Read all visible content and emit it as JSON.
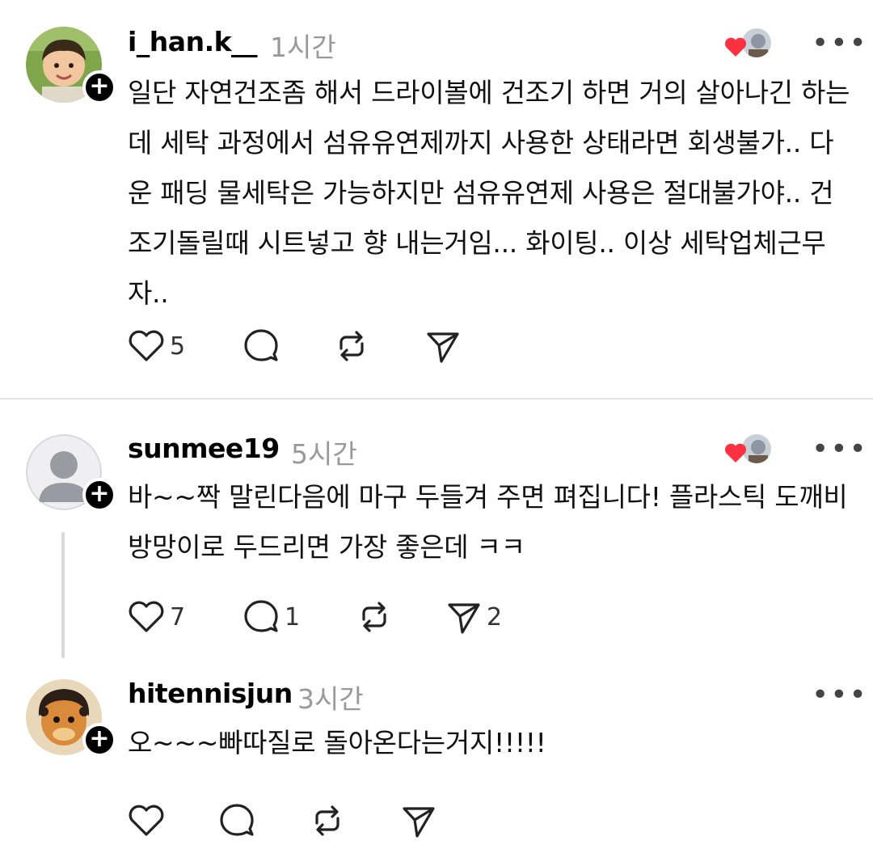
{
  "posts": [
    {
      "username": "i_han.k__",
      "time": "1시간",
      "body": "일단 자연건조좀 해서 드라이볼에 건조기 하면 거의 살아나긴 하는데 세탁 과정에서 섬유유연제까지 사용한 상태라면 회생불가.. 다운 패딩 물세탁은 가능하지만 섬유유연제 사용은 절대불가야.. 건조기돌릴때 시트넣고 향 내는거임... 화이팅.. 이상 세탁업체근무자..",
      "likes": "5",
      "replies": "",
      "shares": ""
    },
    {
      "username": "sunmee19",
      "time": "5시간",
      "body": "바~~짝 말린다음에 마구 두들겨 주면 펴집니다! 플라스틱 도깨비 방망이로 두드리면 가장 좋은데 ㅋㅋ",
      "likes": "7",
      "replies": "1",
      "shares": "2"
    },
    {
      "username": "hitennisjun",
      "time": "3시간",
      "body": "오~~~빠따질로 돌아온다는거지!!!!!",
      "likes": "",
      "replies": "",
      "shares": ""
    }
  ],
  "icons": {
    "follow": "+",
    "more": "•••",
    "like": "heart-outline-icon",
    "reply": "comment-bubble-icon",
    "repost": "repost-icon",
    "share": "send-icon"
  },
  "colors": {
    "accent_heart": "#ff3040",
    "timestamp": "#999999",
    "divider": "#e2e2e2"
  }
}
